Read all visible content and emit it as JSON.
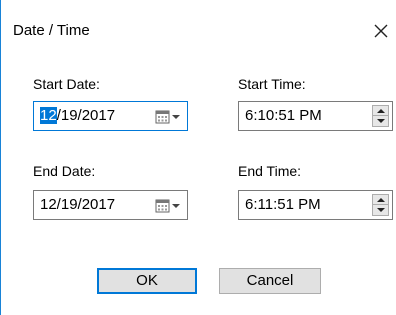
{
  "dialog": {
    "title": "Date / Time",
    "close_label": "✕"
  },
  "start_date": {
    "label": "Start Date:",
    "value_selected": "12",
    "value_rest": "/19/2017",
    "dropdown_icon": "calendar-dropdown-icon"
  },
  "start_time": {
    "label": "Start Time:",
    "value": "6:10:51 PM"
  },
  "end_date": {
    "label": "End Date:",
    "value": "12/19/2017",
    "dropdown_icon": "calendar-dropdown-icon"
  },
  "end_time": {
    "label": "End Time:",
    "value": "6:11:51 PM"
  },
  "buttons": {
    "ok": "OK",
    "cancel": "Cancel"
  },
  "colors": {
    "accent": "#0078d7",
    "border": "#7a7a7a"
  }
}
